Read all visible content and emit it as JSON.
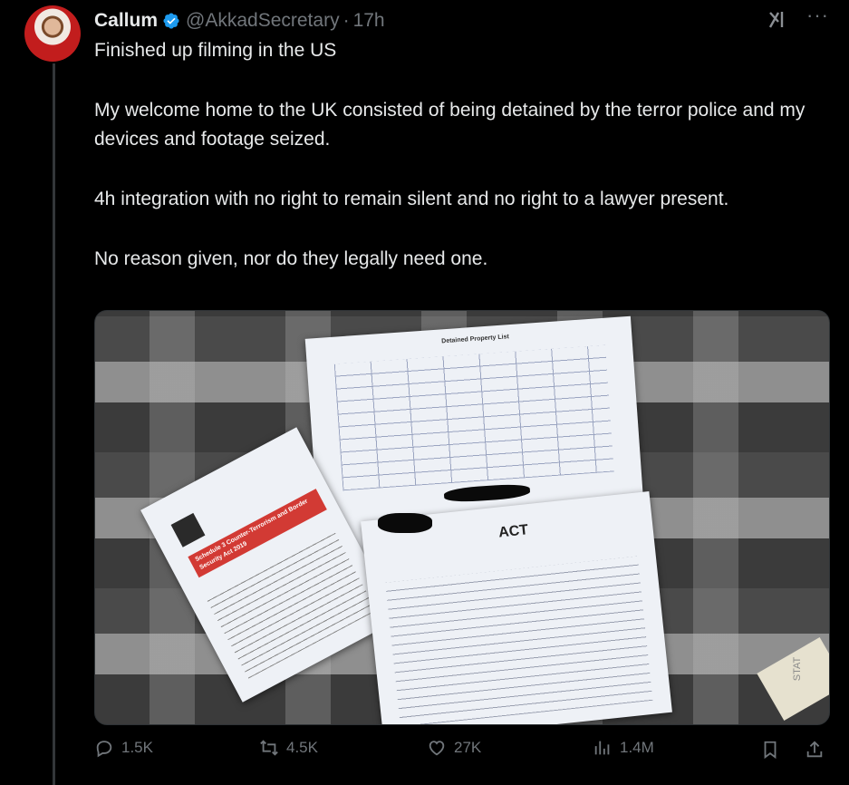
{
  "tweet": {
    "name": "Callum",
    "handle": "@AkkadSecretary",
    "separator": "·",
    "time": "17h",
    "paragraphs": [
      "Finished up filming in the US",
      "My welcome home to the UK consisted of being detained by the terror police and my devices and footage seized.",
      "4h integration with no right to remain silent and no right to a lawyer present.",
      "No reason given, nor do they legally need one."
    ],
    "more_label": "···"
  },
  "image": {
    "doc_title_1": "Detained Property List",
    "doc_act": "ACT",
    "doc_band": "Schedule 3 Counter-Terrorism and Border Security Act 2019",
    "sticker": "STAT"
  },
  "actions": {
    "replies": "1.5K",
    "reposts": "4.5K",
    "likes": "27K",
    "views": "1.4M"
  },
  "colors": {
    "accent": "#1d9bf0",
    "muted": "#71767b",
    "text": "#e7e9ea"
  }
}
